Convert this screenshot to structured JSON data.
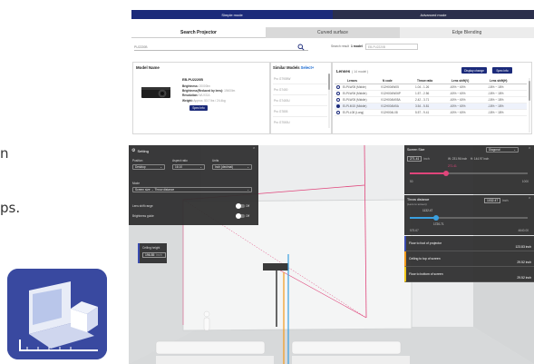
{
  "fragments": {
    "line1": "n",
    "line2": "ps."
  },
  "modes": {
    "simple": "Simple mode",
    "advanced": "Advanced mode"
  },
  "tabs": {
    "search": "Search Projector",
    "curved": "Curved surface",
    "edge": "Edge Blending"
  },
  "search": {
    "value": "PU2220B",
    "result_label": "Search result",
    "result_count": "1 model",
    "result_value": "EB-PU2220B"
  },
  "model": {
    "header": "Model Name",
    "name": "EB-PU2220B",
    "brightness_label": "Brightness:",
    "brightness": "20000lm",
    "brightness_tele_label": "Brightness(Reduced by lens):",
    "brightness_tele": "19400lm",
    "resolution_label": "Resolution:",
    "resolution": "WUXGA",
    "weight_label": "Weight:",
    "weight": "Approx. 53.7 lbs / 24.4kg",
    "spec_button": "Spec Info"
  },
  "similar": {
    "header": "Similar Models",
    "select": "Select+",
    "items": [
      "Pro G7905W",
      "Pro G7400",
      "Pro G7400U",
      "Pro G7805",
      "Pro G7500U"
    ]
  },
  "lenses": {
    "header": "Lenses",
    "count": "( 14 model )",
    "display_button": "Display change",
    "spec_button": "Spec info",
    "columns": [
      "Lenses",
      "N code",
      "Throw ratio",
      "Lens shift(V)",
      "Lens shift(H)"
    ],
    "rows": [
      [
        "ELPLW05 (Midde)",
        "V12H004W05",
        "1.04 - 1.26",
        "-60% ~ 60%",
        "-18% ~ 18%"
      ],
      [
        "ELPLW06 (Middle)",
        "V12H004W06P",
        "1.57 - 2.56",
        "-60% ~ 60%",
        "-18% ~ 18%"
      ],
      [
        "ELPLW05 (Middle)",
        "V12H004M05A",
        "2.42 - 3.71",
        "-60% ~ 60%",
        "-18% ~ 18%"
      ],
      [
        "ELPLM15 (Middle)",
        "V12H004M0A",
        "3.54 - 5.81",
        "-60% ~ 60%",
        "-18% ~ 18%"
      ],
      [
        "ELPLL08 (Long)",
        "V12H004L08",
        "5.57 - 9.41",
        "-60% ~ 60%",
        "-18% ~ 18%"
      ]
    ],
    "selected_index": 3
  },
  "setting": {
    "title": "Setting",
    "position_label": "Position",
    "position_value": "Desktop",
    "aspect_label": "Aspect ratio",
    "aspect_value": "16:10",
    "units_label": "Units",
    "units_value": "Inch (decimal)",
    "mode_label": "Mode",
    "mode_value": "Screen size → Throw distance",
    "lens_shift_label": "Lens shift range",
    "lens_shift_state": "Off",
    "brightness_guide_label": "Brightness guide",
    "brightness_guide_state": "Off"
  },
  "screen": {
    "title": "Screen Size",
    "type": "Diagonal",
    "diag_value": "271.41",
    "diag_unit": "inch",
    "dims": "W: 231.96 inch    H: 144.97 inch",
    "slider_label": "271.41",
    "slider_value": 0.31,
    "min": "50",
    "max": "1000"
  },
  "throw": {
    "title": "Throw distance",
    "subtitle": "(Lens to screen)",
    "value": "1032.47",
    "unit": "inch",
    "upper_label": "1132.47",
    "lower_label": "1720.71",
    "slider_value": 0.22,
    "min": "575.67",
    "max": "4640.00"
  },
  "rows": [
    {
      "label": "Floor to foot of projector",
      "value": "123.83 inch"
    },
    {
      "label": "Ceiling to top of screen",
      "value": "29.52 inch"
    },
    {
      "label": "Floor to bottom of screen",
      "value": "29.52 inch"
    }
  ],
  "ceiling": {
    "label": "Ceiling height",
    "value": "196.85",
    "unit": "inch"
  },
  "colors": {
    "navy": "#1b2a7a",
    "pink": "#e0457b",
    "orange": "#f29a1b",
    "blue": "#3aa0e0",
    "panel": "#303030"
  }
}
